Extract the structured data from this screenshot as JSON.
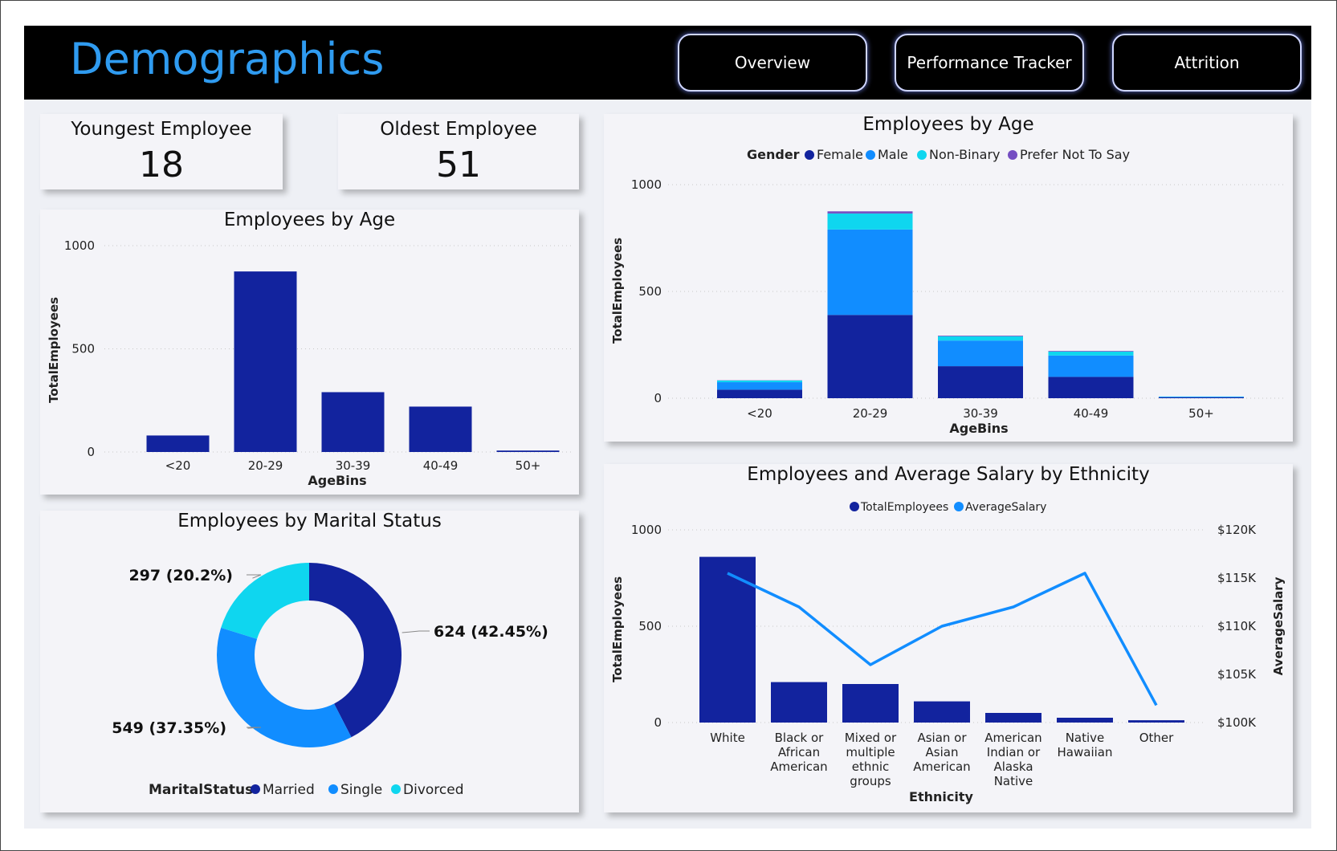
{
  "header": {
    "title": "Demographics",
    "nav": [
      "Overview",
      "Performance Tracker",
      "Attrition"
    ]
  },
  "kpis": {
    "youngest": {
      "label": "Youngest Employee",
      "value": "18"
    },
    "oldest": {
      "label": "Oldest Employee",
      "value": "51"
    }
  },
  "colors": {
    "title": "#2f9bf0",
    "female": "#12239e",
    "male": "#118dff",
    "non_binary": "#0fd6ef",
    "prefer_not": "#744ec2",
    "married": "#12239e",
    "single": "#118dff",
    "divorced": "#0fd6ef",
    "bar": "#12239e",
    "line": "#118dff"
  },
  "chart_data": [
    {
      "type": "bar",
      "title": "Employees by Age",
      "xlabel": "AgeBins",
      "ylabel": "TotalEmployees",
      "categories": [
        "<20",
        "20-29",
        "30-39",
        "40-49",
        "50+"
      ],
      "values": [
        80,
        875,
        290,
        220,
        7
      ],
      "ylim": [
        0,
        1000
      ],
      "yticks": [
        "0",
        "500",
        "1000"
      ],
      "grid": true
    },
    {
      "type": "bar",
      "stacked": true,
      "title": "Employees by Age",
      "xlabel": "AgeBins",
      "ylabel": "TotalEmployees",
      "legend_title": "Gender",
      "legend_position": "top",
      "categories": [
        "<20",
        "20-29",
        "30-39",
        "40-49",
        "50+"
      ],
      "series": [
        {
          "name": "Female",
          "values": [
            40,
            390,
            150,
            100,
            4
          ]
        },
        {
          "name": "Male",
          "values": [
            35,
            400,
            120,
            100,
            3
          ]
        },
        {
          "name": "Non-Binary",
          "values": [
            8,
            75,
            20,
            18,
            1
          ]
        },
        {
          "name": "Prefer Not To Say",
          "values": [
            1,
            10,
            3,
            3,
            0
          ]
        }
      ],
      "ylim": [
        0,
        1000
      ],
      "yticks": [
        "0",
        "500",
        "1000"
      ],
      "grid": true
    },
    {
      "type": "pie",
      "donut": true,
      "title": "Employees by Marital Status",
      "legend_title": "MaritalStatus",
      "legend_position": "bottom",
      "slices": [
        {
          "name": "Married",
          "value": 624,
          "label": "624 (42.45%)"
        },
        {
          "name": "Single",
          "value": 549,
          "label": "549 (37.35%)"
        },
        {
          "name": "Divorced",
          "value": 297,
          "label": "297 (20.2%)"
        }
      ]
    },
    {
      "type": "bar",
      "combo": "bar+line",
      "title": "Employees and Average Salary by Ethnicity",
      "xlabel": "Ethnicity",
      "ylabel": "TotalEmployees",
      "y2label": "AverageSalary",
      "legend_position": "top",
      "categories": [
        "White",
        "Black or African American",
        "Mixed or multiple ethnic groups",
        "Asian or Asian American",
        "American Indian or Alaska Native",
        "Native Hawaiian",
        "Other"
      ],
      "category_lines": [
        [
          "White"
        ],
        [
          "Black or",
          "African",
          "American"
        ],
        [
          "Mixed or",
          "multiple",
          "ethnic",
          "groups"
        ],
        [
          "Asian or",
          "Asian",
          "American"
        ],
        [
          "American",
          "Indian or",
          "Alaska",
          "Native"
        ],
        [
          "Native",
          "Hawaiian"
        ],
        [
          "Other"
        ]
      ],
      "series": [
        {
          "name": "TotalEmployees",
          "type": "bar",
          "values": [
            860,
            210,
            200,
            110,
            50,
            25,
            12
          ]
        },
        {
          "name": "AverageSalary",
          "type": "line",
          "values": [
            115500,
            112000,
            106000,
            110000,
            112000,
            115500,
            101800
          ]
        }
      ],
      "ylim": [
        0,
        1000
      ],
      "y2lim": [
        100000,
        120000
      ],
      "yticks": [
        "0",
        "500",
        "1000"
      ],
      "y2ticks": [
        "$100K",
        "$105K",
        "$110K",
        "$115K",
        "$120K"
      ],
      "grid": true
    }
  ]
}
